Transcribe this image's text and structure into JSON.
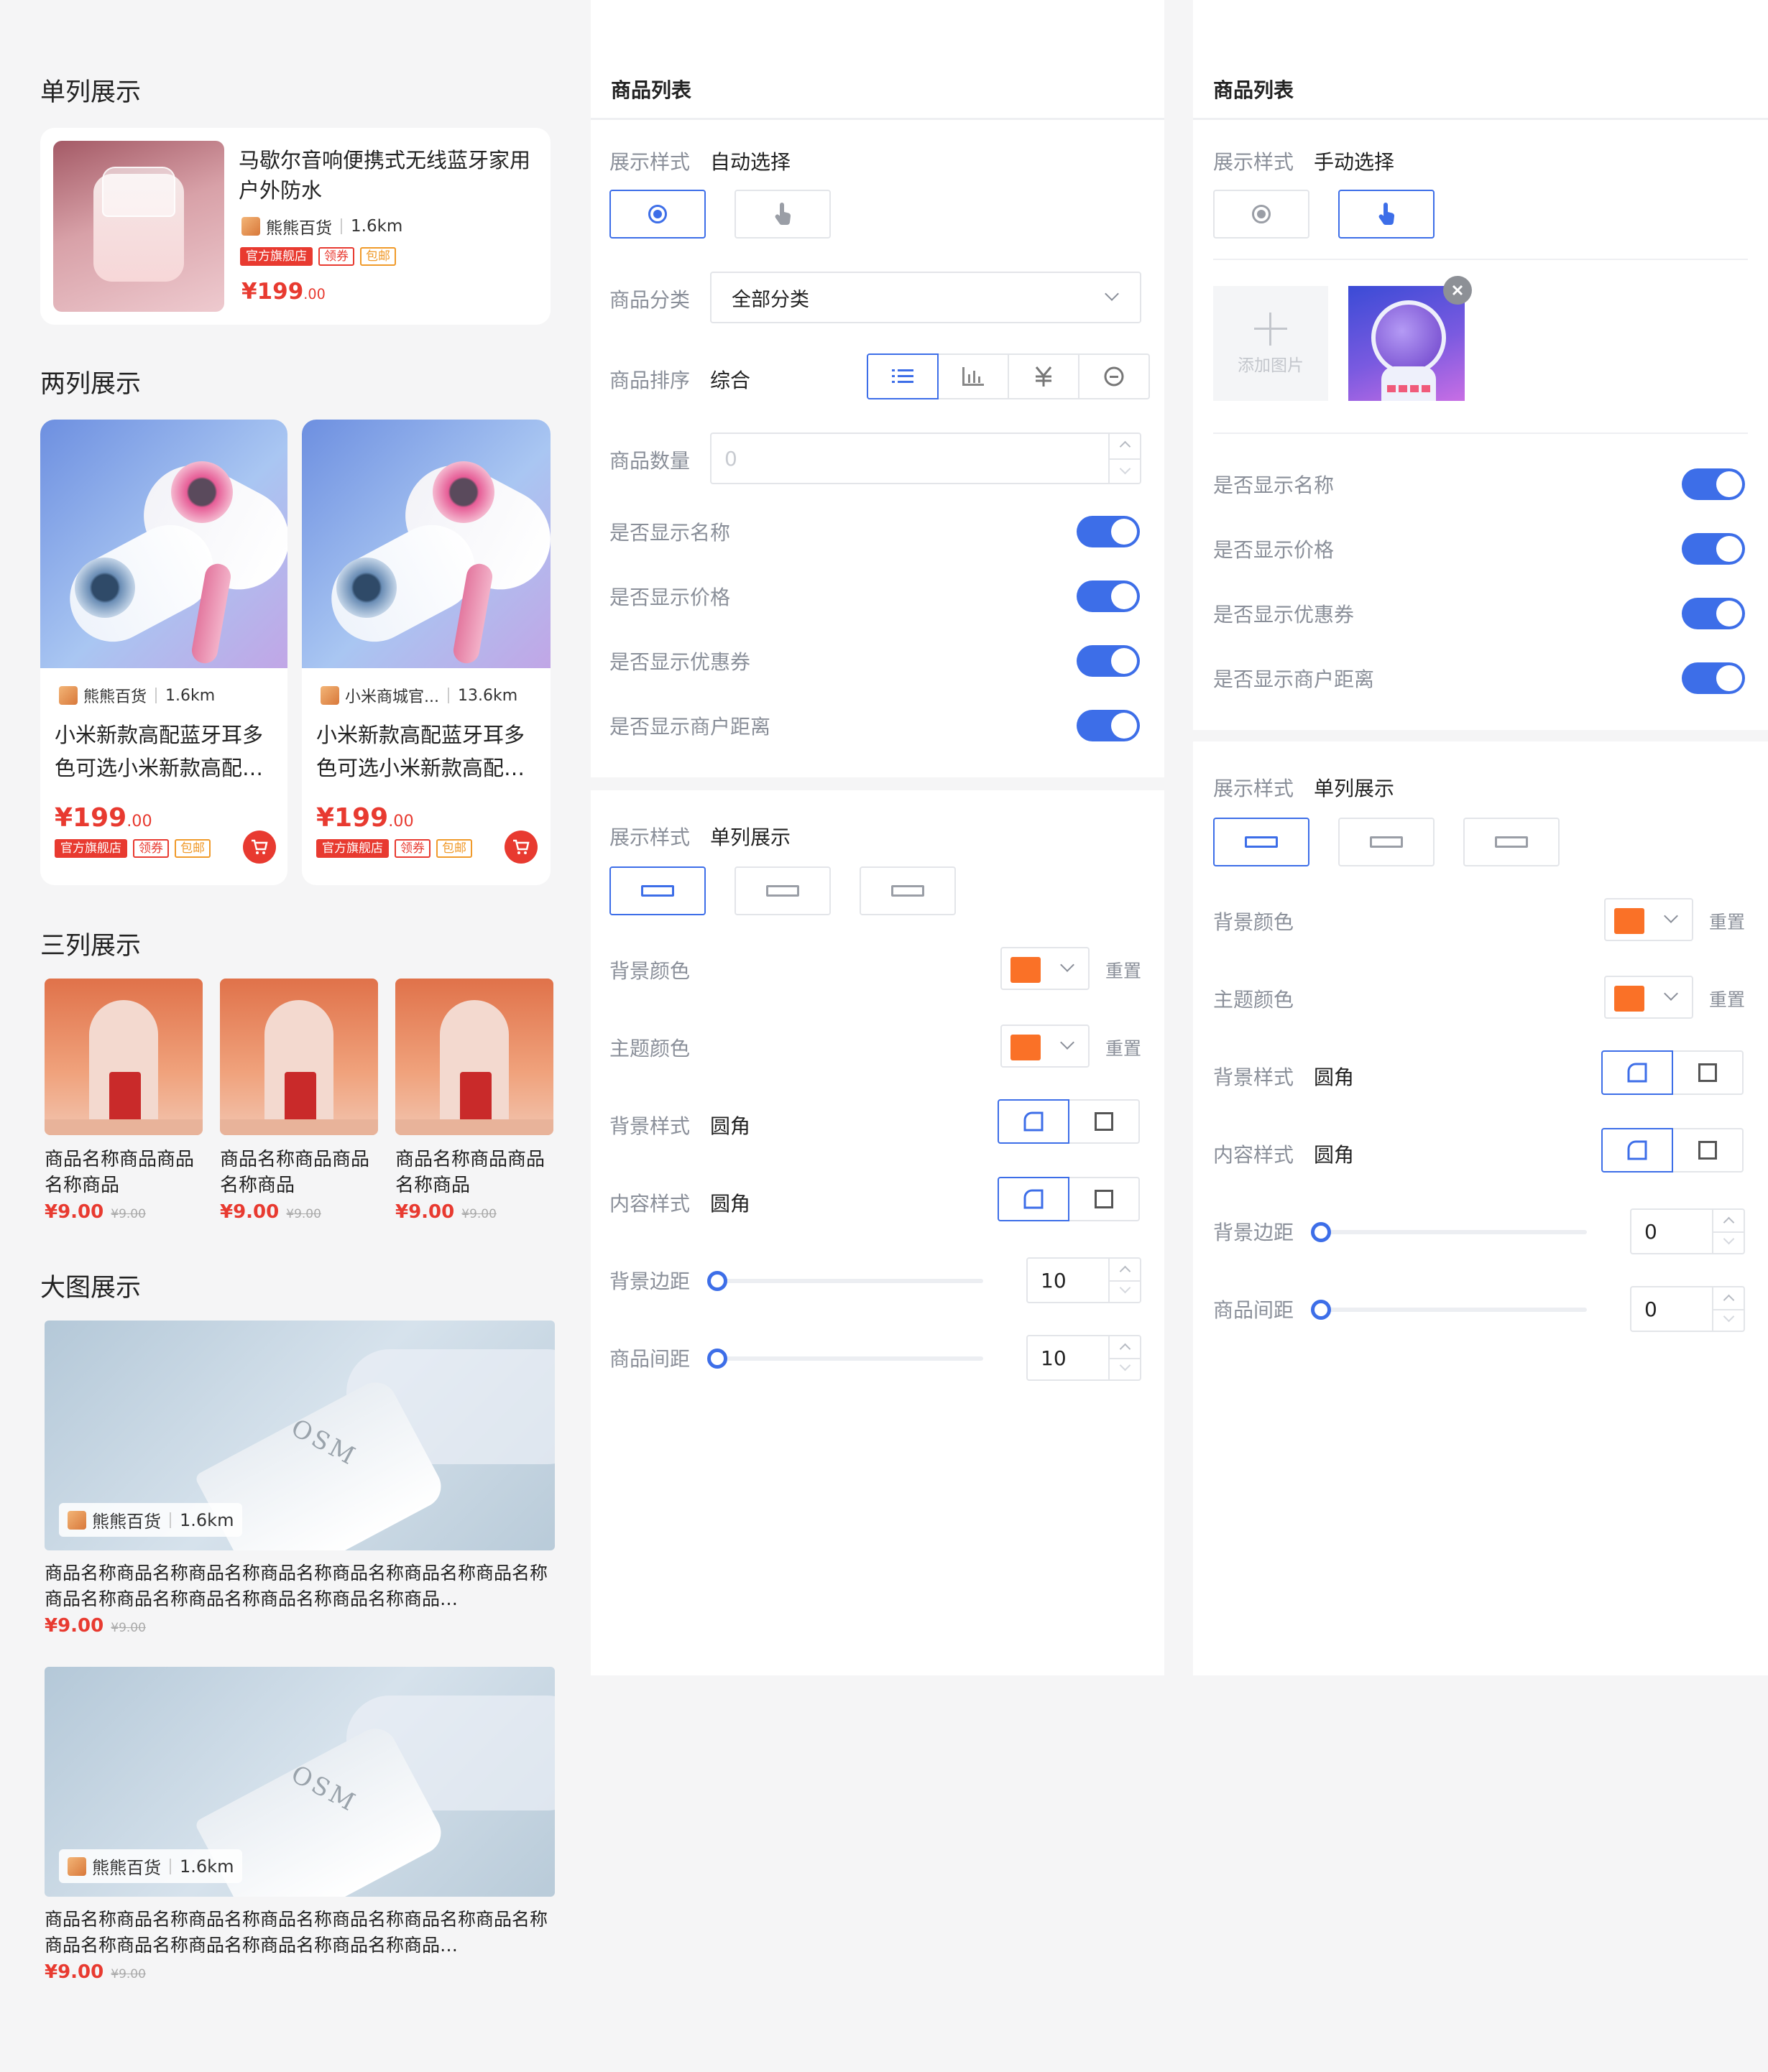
{
  "preview": {
    "single": {
      "title": "单列展示",
      "product_name": "马歇尔音响便携式无线蓝牙家用户外防水",
      "shop": "熊熊百货",
      "distance": "1.6km",
      "tags": [
        "官方旗舰店",
        "领券",
        "包邮"
      ],
      "price_int": "¥199",
      "price_dec": ".00"
    },
    "double": {
      "title": "两列展示",
      "items": [
        {
          "shop": "熊熊百货",
          "distance": "1.6km",
          "name": "小米新款高配蓝牙耳多色可选小米新款高配…",
          "price_int": "¥199",
          "price_dec": ".00",
          "tags": [
            "官方旗舰店",
            "领券",
            "包邮"
          ]
        },
        {
          "shop": "小米商城官...",
          "distance": "13.6km",
          "name": "小米新款高配蓝牙耳多色可选小米新款高配…",
          "price_int": "¥199",
          "price_dec": ".00",
          "tags": [
            "官方旗舰店",
            "领券",
            "包邮"
          ]
        }
      ]
    },
    "triple": {
      "title": "三列展示",
      "items": [
        {
          "name": "商品名称商品商品名称商品",
          "price": "¥9.00",
          "old_price": "¥9.00"
        },
        {
          "name": "商品名称商品商品名称商品",
          "price": "¥9.00",
          "old_price": "¥9.00"
        },
        {
          "name": "商品名称商品商品名称商品",
          "price": "¥9.00",
          "old_price": "¥9.00"
        }
      ]
    },
    "big": {
      "title": "大图展示",
      "brand_on_image": "OSM",
      "items": [
        {
          "shop": "熊熊百货",
          "distance": "1.6km",
          "name": "商品名称商品名称商品名称商品名称商品名称商品名称商品名称商品名称商品名称商品名称商品名称商品名称商品…",
          "price": "¥9.00",
          "old_price": "¥9.00"
        },
        {
          "shop": "熊熊百货",
          "distance": "1.6km",
          "name": "商品名称商品名称商品名称商品名称商品名称商品名称商品名称商品名称商品名称商品名称商品名称商品名称商品…",
          "price": "¥9.00",
          "old_price": "¥9.00"
        }
      ]
    }
  },
  "panel_auto": {
    "title": "商品列表",
    "display_mode_label": "展示样式",
    "display_mode_value": "自动选择",
    "category_label": "商品分类",
    "category_value": "全部分类",
    "sort_label": "商品排序",
    "sort_value": "综合",
    "count_label": "商品数量",
    "count_placeholder": "0",
    "toggles": [
      {
        "label": "是否显示名称",
        "on": true
      },
      {
        "label": "是否显示价格",
        "on": true
      },
      {
        "label": "是否显示优惠券",
        "on": true
      },
      {
        "label": "是否显示商户距离",
        "on": true
      }
    ]
  },
  "panel_auto_style": {
    "display_label": "展示样式",
    "display_value": "单列展示",
    "bg_color_label": "背景颜色",
    "theme_color_label": "主题颜色",
    "color": "#fa7127",
    "reset": "重置",
    "bg_style_label": "背景样式",
    "bg_style_value": "圆角",
    "content_style_label": "内容样式",
    "content_style_value": "圆角",
    "bg_margin_label": "背景边距",
    "bg_margin_value": "10",
    "item_gap_label": "商品间距",
    "item_gap_value": "10"
  },
  "panel_manual": {
    "title": "商品列表",
    "display_mode_label": "展示样式",
    "display_mode_value": "手动选择",
    "add_image": "添加图片",
    "toggles": [
      {
        "label": "是否显示名称",
        "on": true
      },
      {
        "label": "是否显示价格",
        "on": true
      },
      {
        "label": "是否显示优惠券",
        "on": true
      },
      {
        "label": "是否显示商户距离",
        "on": true
      }
    ]
  },
  "panel_manual_style": {
    "display_label": "展示样式",
    "display_value": "单列展示",
    "bg_color_label": "背景颜色",
    "theme_color_label": "主题颜色",
    "color": "#fa7127",
    "reset": "重置",
    "bg_style_label": "背景样式",
    "bg_style_value": "圆角",
    "content_style_label": "内容样式",
    "content_style_value": "圆角",
    "bg_margin_label": "背景边距",
    "bg_margin_value": "0",
    "item_gap_label": "商品间距",
    "item_gap_value": "0"
  },
  "colors": {
    "accent": "#3d6ee8",
    "price": "#e83a30",
    "orange": "#fa7127"
  }
}
